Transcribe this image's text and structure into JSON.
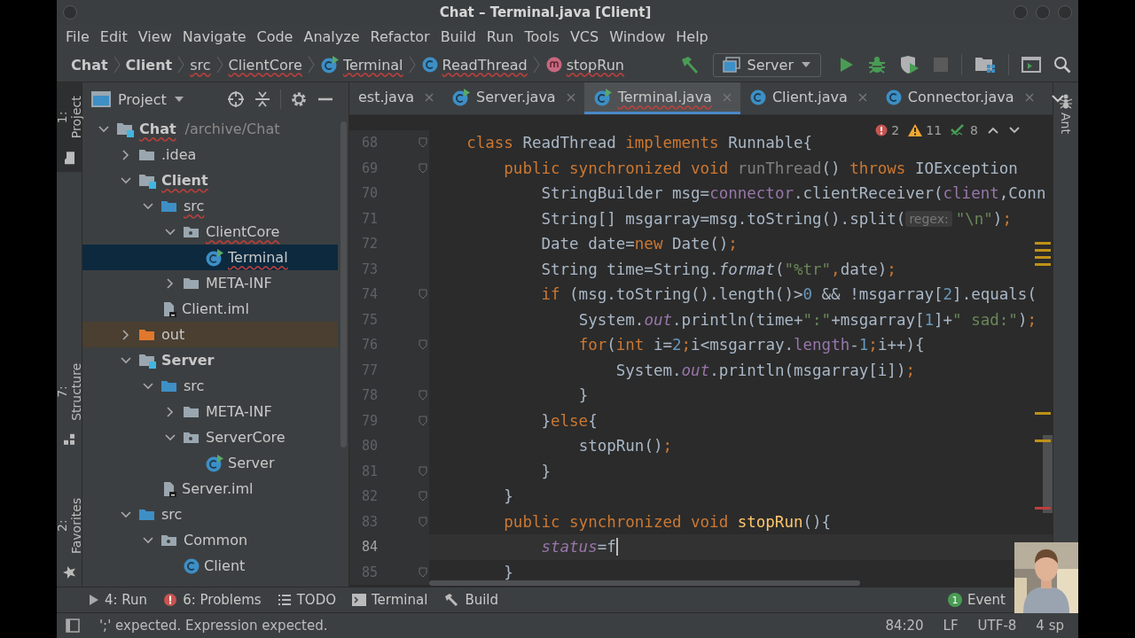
{
  "window": {
    "title": "Chat – Terminal.java [Client]"
  },
  "menu": [
    "File",
    "Edit",
    "View",
    "Navigate",
    "Code",
    "Analyze",
    "Refactor",
    "Build",
    "Run",
    "Tools",
    "VCS",
    "Window",
    "Help"
  ],
  "breadcrumbs": [
    {
      "label": "Chat",
      "kind": "module",
      "error": false
    },
    {
      "label": "Client",
      "kind": "module",
      "error": false
    },
    {
      "label": "src",
      "kind": "folder",
      "error": true
    },
    {
      "label": "ClientCore",
      "kind": "package",
      "error": true
    },
    {
      "label": "Terminal",
      "kind": "class-main",
      "error": true
    },
    {
      "label": "ReadThread",
      "kind": "class",
      "error": true
    },
    {
      "label": "stopRun",
      "kind": "method",
      "error": true
    }
  ],
  "toolbar": [
    {
      "kind": "build"
    },
    {
      "kind": "run_config",
      "label": "Server"
    },
    {
      "kind": "run"
    },
    {
      "kind": "debug"
    },
    {
      "kind": "coverage"
    },
    {
      "kind": "stop",
      "disabled": true
    },
    {
      "kind": "separator"
    },
    {
      "kind": "project_structure"
    },
    {
      "kind": "separator"
    },
    {
      "kind": "terminal"
    },
    {
      "kind": "search"
    }
  ],
  "left_strip": [
    {
      "label": "1: Project",
      "kind": "folder",
      "selected": true
    },
    {
      "label": "7: Structure",
      "kind": "structure",
      "selected": false
    },
    {
      "label": "2: Favorites",
      "kind": "star",
      "selected": false
    }
  ],
  "right_strip": [
    {
      "label": "Ant"
    }
  ],
  "project": {
    "title": "Project",
    "tree": [
      {
        "label": "Chat",
        "path": "/archive/Chat",
        "kind": "module",
        "expanded": true,
        "selected": false,
        "error": true,
        "children": [
          {
            "label": ".idea",
            "kind": "folder",
            "expanded": false,
            "selected": false,
            "error": false
          },
          {
            "label": "Client",
            "kind": "module",
            "expanded": true,
            "selected": false,
            "error": true,
            "children": [
              {
                "label": "src",
                "kind": "source",
                "expanded": true,
                "selected": false,
                "error": true,
                "children": [
                  {
                    "label": "ClientCore",
                    "kind": "package",
                    "expanded": true,
                    "selected": false,
                    "error": true,
                    "children": [
                      {
                        "label": "Terminal",
                        "kind": "class-main",
                        "selected": true,
                        "error": true
                      }
                    ]
                  },
                  {
                    "label": "META-INF",
                    "kind": "folder",
                    "expanded": false,
                    "selected": false,
                    "error": false
                  }
                ]
              },
              {
                "label": "Client.iml",
                "kind": "iml",
                "selected": false,
                "error": false
              }
            ]
          },
          {
            "label": "out",
            "kind": "excluded",
            "expanded": false,
            "selected": false,
            "error": false
          },
          {
            "label": "Server",
            "kind": "module",
            "expanded": true,
            "selected": false,
            "error": false,
            "children": [
              {
                "label": "src",
                "kind": "source",
                "expanded": true,
                "selected": false,
                "error": false,
                "children": [
                  {
                    "label": "META-INF",
                    "kind": "folder",
                    "expanded": false,
                    "selected": false,
                    "error": false
                  },
                  {
                    "label": "ServerCore",
                    "kind": "package",
                    "expanded": true,
                    "selected": false,
                    "error": false,
                    "children": [
                      {
                        "label": "Server",
                        "kind": "class-main",
                        "selected": false,
                        "error": false
                      }
                    ]
                  }
                ]
              },
              {
                "label": "Server.iml",
                "kind": "iml",
                "selected": false,
                "error": false
              }
            ]
          },
          {
            "label": "src",
            "kind": "source",
            "expanded": true,
            "selected": false,
            "error": false,
            "children": [
              {
                "label": "Common",
                "kind": "package",
                "expanded": true,
                "selected": false,
                "error": false,
                "children": [
                  {
                    "label": "Client",
                    "kind": "class",
                    "selected": false,
                    "error": false
                  }
                ]
              }
            ]
          }
        ]
      }
    ]
  },
  "tabs": [
    {
      "label": "est.java",
      "selected": false,
      "error": false
    },
    {
      "label": "Server.java",
      "kind": "class-main",
      "selected": false,
      "error": false
    },
    {
      "label": "Terminal.java",
      "kind": "class-main",
      "selected": true,
      "error": true
    },
    {
      "label": "Client.java",
      "kind": "class",
      "selected": false,
      "error": false
    },
    {
      "label": "Connector.java",
      "kind": "class",
      "selected": false,
      "error": false
    }
  ],
  "inspections": {
    "errors": "2",
    "warnings": "11",
    "weak_warnings": "8"
  },
  "editor": {
    "lines": [
      {
        "number": "68",
        "fold": true,
        "current": false,
        "tokens": [
          {
            "kind": "kw",
            "text": "class "
          },
          {
            "kind": "txt",
            "text": "ReadThread "
          },
          {
            "kind": "kw",
            "text": "implements "
          },
          {
            "kind": "txt",
            "text": "Runnable{"
          }
        ],
        "children": [
          {
            "number": "69",
            "fold": true,
            "current": false,
            "tokens": [
              {
                "kind": "kw",
                "text": "public synchronized void "
              },
              {
                "kind": "unused",
                "text": "runThread"
              },
              {
                "kind": "txt",
                "text": "() "
              },
              {
                "kind": "kw",
                "text": "throws "
              },
              {
                "kind": "txt",
                "text": "IOException"
              }
            ],
            "children": [
              {
                "number": "70",
                "fold": false,
                "current": false,
                "tokens": [
                  {
                    "kind": "txt",
                    "text": "StringBuilder msg="
                  },
                  {
                    "kind": "field",
                    "text": "connector"
                  },
                  {
                    "kind": "txt",
                    "text": ".clientReceiver("
                  },
                  {
                    "kind": "field",
                    "text": "client"
                  },
                  {
                    "kind": "txt",
                    "text": ",Conn"
                  }
                ]
              },
              {
                "number": "71",
                "fold": false,
                "current": false,
                "tokens": [
                  {
                    "kind": "txt",
                    "text": "String[] msgarray=msg.toString().split("
                  },
                  {
                    "kind": "hint",
                    "text": "regex:"
                  },
                  {
                    "kind": "str",
                    "text": "\"\\n\""
                  },
                  {
                    "kind": "txt",
                    "text": ")"
                  },
                  {
                    "kind": "kw",
                    "text": ";"
                  }
                ]
              },
              {
                "number": "72",
                "fold": false,
                "current": false,
                "tokens": [
                  {
                    "kind": "txt",
                    "text": "Date date="
                  },
                  {
                    "kind": "kw",
                    "text": "new "
                  },
                  {
                    "kind": "txt",
                    "text": "Date()"
                  },
                  {
                    "kind": "kw",
                    "text": ";"
                  }
                ]
              },
              {
                "number": "73",
                "fold": false,
                "current": false,
                "tokens": [
                  {
                    "kind": "txt",
                    "text": "String time=String."
                  },
                  {
                    "kind": "italic",
                    "text": "format"
                  },
                  {
                    "kind": "txt",
                    "text": "("
                  },
                  {
                    "kind": "str",
                    "text": "\"%tr\""
                  },
                  {
                    "kind": "kw",
                    "text": ","
                  },
                  {
                    "kind": "txt",
                    "text": "date)"
                  },
                  {
                    "kind": "kw",
                    "text": ";"
                  }
                ]
              },
              {
                "number": "74",
                "fold": true,
                "current": false,
                "tokens": [
                  {
                    "kind": "kw",
                    "text": "if "
                  },
                  {
                    "kind": "txt",
                    "text": "(msg.toString().length()>"
                  },
                  {
                    "kind": "num",
                    "text": "0"
                  },
                  {
                    "kind": "txt",
                    "text": " && !msgarray["
                  },
                  {
                    "kind": "num",
                    "text": "2"
                  },
                  {
                    "kind": "txt",
                    "text": "].equals("
                  }
                ],
                "children": [
                  {
                    "number": "75",
                    "fold": false,
                    "current": false,
                    "tokens": [
                      {
                        "kind": "txt",
                        "text": "System."
                      },
                      {
                        "kind": "static",
                        "text": "out"
                      },
                      {
                        "kind": "txt",
                        "text": ".println(time+"
                      },
                      {
                        "kind": "str",
                        "text": "\":\""
                      },
                      {
                        "kind": "txt",
                        "text": "+msgarray["
                      },
                      {
                        "kind": "num",
                        "text": "1"
                      },
                      {
                        "kind": "txt",
                        "text": "]+"
                      },
                      {
                        "kind": "str",
                        "text": "\" sad:\""
                      },
                      {
                        "kind": "txt",
                        "text": ")"
                      },
                      {
                        "kind": "kw",
                        "text": ";"
                      }
                    ]
                  },
                  {
                    "number": "76",
                    "fold": true,
                    "current": false,
                    "tokens": [
                      {
                        "kind": "kw",
                        "text": "for"
                      },
                      {
                        "kind": "txt",
                        "text": "("
                      },
                      {
                        "kind": "kw",
                        "text": "int "
                      },
                      {
                        "kind": "txt",
                        "text": "i="
                      },
                      {
                        "kind": "num",
                        "text": "2"
                      },
                      {
                        "kind": "kw",
                        "text": ";"
                      },
                      {
                        "kind": "txt",
                        "text": "i<msgarray."
                      },
                      {
                        "kind": "field",
                        "text": "length"
                      },
                      {
                        "kind": "txt",
                        "text": "-"
                      },
                      {
                        "kind": "num",
                        "text": "1"
                      },
                      {
                        "kind": "kw",
                        "text": ";"
                      },
                      {
                        "kind": "txt",
                        "text": "i++){"
                      }
                    ],
                    "children": [
                      {
                        "number": "77",
                        "fold": false,
                        "current": false,
                        "tokens": [
                          {
                            "kind": "txt",
                            "text": "System."
                          },
                          {
                            "kind": "static",
                            "text": "out"
                          },
                          {
                            "kind": "txt",
                            "text": ".println(msgarray[i])"
                          },
                          {
                            "kind": "kw",
                            "text": ";"
                          }
                        ]
                      }
                    ]
                  },
                  {
                    "number": "78",
                    "fold": true,
                    "current": false,
                    "tokens": [
                      {
                        "kind": "txt",
                        "text": "}"
                      }
                    ]
                  }
                ]
              },
              {
                "number": "79",
                "fold": true,
                "current": false,
                "tokens": [
                  {
                    "kind": "txt",
                    "text": "}"
                  },
                  {
                    "kind": "kw",
                    "text": "else"
                  },
                  {
                    "kind": "txt",
                    "text": "{"
                  }
                ],
                "children": [
                  {
                    "number": "80",
                    "fold": false,
                    "current": false,
                    "tokens": [
                      {
                        "kind": "txt",
                        "text": "stopRun()"
                      },
                      {
                        "kind": "kw",
                        "text": ";"
                      }
                    ]
                  }
                ]
              },
              {
                "number": "81",
                "fold": true,
                "current": false,
                "tokens": [
                  {
                    "kind": "txt",
                    "text": "}"
                  }
                ]
              }
            ]
          },
          {
            "number": "82",
            "fold": true,
            "current": false,
            "tokens": [
              {
                "kind": "txt",
                "text": "}"
              }
            ]
          },
          {
            "number": "83",
            "fold": true,
            "current": false,
            "tokens": [
              {
                "kind": "kw",
                "text": "public synchronized void "
              },
              {
                "kind": "decl",
                "text": "stopRun"
              },
              {
                "kind": "txt",
                "text": "(){"
              }
            ],
            "children": [
              {
                "number": "84",
                "fold": false,
                "current": true,
                "tokens": [
                  {
                    "kind": "static",
                    "text": "status"
                  },
                  {
                    "kind": "txt",
                    "text": "=f"
                  }
                ]
              }
            ]
          },
          {
            "number": "85",
            "fold": true,
            "current": false,
            "tokens": [
              {
                "kind": "txt",
                "text": "}"
              }
            ]
          }
        ]
      }
    ]
  },
  "tool_windows": [
    {
      "label": "4: Run",
      "kind": "run"
    },
    {
      "label": "6: Problems",
      "kind": "problems"
    },
    {
      "label": "TODO",
      "kind": "todo"
    },
    {
      "label": "Terminal",
      "kind": "terminal"
    },
    {
      "label": "Build",
      "kind": "build"
    }
  ],
  "event_log": {
    "label": "Event",
    "badge": "1"
  },
  "status_bar": {
    "message": "';' expected. Expression expected.",
    "position": "84:20",
    "line_separator": "LF",
    "encoding": "UTF-8",
    "indent": "4 sp"
  }
}
